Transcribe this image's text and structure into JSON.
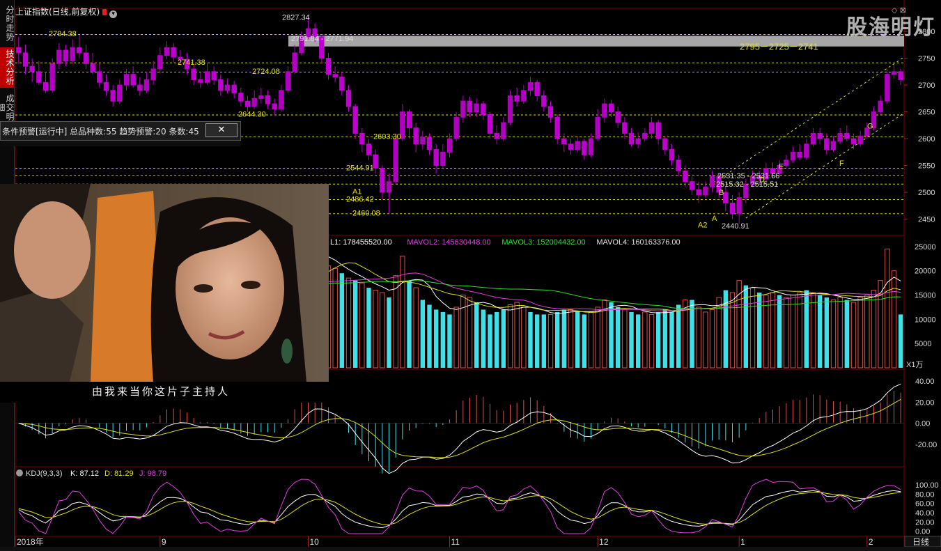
{
  "window": {
    "title": "上证指数(日线,前复权)",
    "watermark": "股海明灯",
    "period_tab": "日线"
  },
  "side_tabs": [
    {
      "label": "分时走势",
      "active": false
    },
    {
      "label": "技术分析",
      "active": true
    },
    {
      "label": "成交明细",
      "active": false
    }
  ],
  "warning_panel": {
    "text": "条件预警[运行中] 总品种数:55 趋势预警:20 条数:45",
    "close": "✕"
  },
  "video": {
    "subtitle": "由我来当你这片子主持人"
  },
  "colors": {
    "up": "#b000c0",
    "down": "#c000d0",
    "hollow_up": "#d4c200",
    "vol_up": "#e05050",
    "vol_down": "#40e0e8",
    "ma1": "#ffffff",
    "ma2": "#e040e0",
    "ma3": "#30e030",
    "ma4": "#e0e020",
    "dash": "#e0e030",
    "grid": "#7a0000"
  },
  "price_panel": {
    "y_ticks": [
      "2800",
      "2750",
      "2700",
      "2650",
      "2600",
      "2550",
      "2500",
      "2450"
    ],
    "annotations": [
      {
        "text": "2827.34"
      },
      {
        "text": "2791.84 - 2771.94"
      },
      {
        "text": "2794.38"
      },
      {
        "text": "2741.38"
      },
      {
        "text": "2724.08"
      },
      {
        "text": "2644.30"
      },
      {
        "text": "2603.30"
      },
      {
        "text": "2544.91"
      },
      {
        "text": "A1"
      },
      {
        "text": "2486.42"
      },
      {
        "text": "2460.08"
      },
      {
        "text": "2795－2725－2741"
      },
      {
        "text": "2531.35 - 2531.66"
      },
      {
        "text": "2515.32 - 2515.51"
      },
      {
        "text": "A2"
      },
      {
        "text": "2440.91"
      },
      {
        "text": "A"
      },
      {
        "text": "B"
      },
      {
        "text": "D"
      },
      {
        "text": "E"
      },
      {
        "text": "F"
      },
      {
        "text": "G"
      }
    ]
  },
  "volume_panel": {
    "legend": [
      {
        "text": "L1: 178455520.00",
        "color": "#ffffff"
      },
      {
        "text": "MAVOL2: 145630448.00",
        "color": "#e040e0"
      },
      {
        "text": "MAVOL3: 152004432.00",
        "color": "#30e030"
      },
      {
        "text": "MAVOL4: 160163376.00",
        "color": "#e0e0e0"
      }
    ],
    "y_ticks": [
      "25000",
      "20000",
      "15000",
      "10000",
      "5000"
    ],
    "unit": "X1万"
  },
  "macd_panel": {
    "y_ticks": [
      "40.00",
      "20.00",
      "0.00",
      "-20.00"
    ]
  },
  "kdj_panel": {
    "name": "KDJ(9,3,3)",
    "k": "K: 87.12",
    "d": "D: 81.29",
    "j": "J: 98.79",
    "y_ticks": [
      "100.00",
      "80.00",
      "60.00",
      "40.00",
      "20.00",
      "0.00"
    ]
  },
  "x_axis": {
    "labels": [
      "2018年",
      "9",
      "10",
      "11",
      "12",
      "1",
      "2"
    ]
  },
  "chart_data": {
    "type": "candlestick",
    "title": "上证指数(日线,前复权)",
    "ylim": [
      2430,
      2830
    ],
    "candles": [
      [
        2770,
        2760,
        2790,
        2740
      ],
      [
        2760,
        2735,
        2775,
        2720
      ],
      [
        2735,
        2725,
        2750,
        2705
      ],
      [
        2725,
        2705,
        2745,
        2700
      ],
      [
        2705,
        2690,
        2725,
        2685
      ],
      [
        2690,
        2740,
        2750,
        2685
      ],
      [
        2740,
        2765,
        2778,
        2730
      ],
      [
        2765,
        2745,
        2775,
        2735
      ],
      [
        2745,
        2770,
        2785,
        2738
      ],
      [
        2770,
        2760,
        2794,
        2750
      ],
      [
        2760,
        2740,
        2775,
        2730
      ],
      [
        2740,
        2725,
        2760,
        2720
      ],
      [
        2725,
        2705,
        2740,
        2695
      ],
      [
        2705,
        2690,
        2720,
        2680
      ],
      [
        2690,
        2670,
        2700,
        2660
      ],
      [
        2670,
        2700,
        2710,
        2665
      ],
      [
        2700,
        2720,
        2730,
        2690
      ],
      [
        2720,
        2700,
        2735,
        2695
      ],
      [
        2700,
        2690,
        2715,
        2680
      ],
      [
        2690,
        2710,
        2725,
        2685
      ],
      [
        2710,
        2730,
        2745,
        2700
      ],
      [
        2730,
        2755,
        2770,
        2722
      ],
      [
        2755,
        2770,
        2782,
        2748
      ],
      [
        2770,
        2752,
        2778,
        2742
      ],
      [
        2752,
        2748,
        2765,
        2740
      ],
      [
        2748,
        2730,
        2760,
        2720
      ],
      [
        2730,
        2710,
        2740,
        2700
      ],
      [
        2710,
        2705,
        2725,
        2695
      ],
      [
        2705,
        2725,
        2741,
        2700
      ],
      [
        2725,
        2710,
        2735,
        2700
      ],
      [
        2710,
        2690,
        2720,
        2680
      ],
      [
        2690,
        2700,
        2712,
        2684
      ],
      [
        2700,
        2685,
        2708,
        2675
      ],
      [
        2685,
        2670,
        2695,
        2660
      ],
      [
        2670,
        2660,
        2680,
        2650
      ],
      [
        2660,
        2675,
        2690,
        2655
      ],
      [
        2675,
        2680,
        2695,
        2665
      ],
      [
        2680,
        2665,
        2690,
        2655
      ],
      [
        2665,
        2655,
        2675,
        2644
      ],
      [
        2655,
        2690,
        2700,
        2650
      ],
      [
        2690,
        2725,
        2735,
        2685
      ],
      [
        2725,
        2760,
        2775,
        2720
      ],
      [
        2760,
        2790,
        2800,
        2755
      ],
      [
        2790,
        2805,
        2827,
        2785
      ],
      [
        2805,
        2790,
        2815,
        2780
      ],
      [
        2790,
        2750,
        2792,
        2740
      ],
      [
        2750,
        2720,
        2760,
        2710
      ],
      [
        2720,
        2715,
        2735,
        2705
      ],
      [
        2715,
        2690,
        2725,
        2680
      ],
      [
        2690,
        2660,
        2700,
        2650
      ],
      [
        2660,
        2610,
        2665,
        2600
      ],
      [
        2610,
        2590,
        2620,
        2575
      ],
      [
        2590,
        2570,
        2600,
        2560
      ],
      [
        2570,
        2545,
        2580,
        2535
      ],
      [
        2545,
        2500,
        2550,
        2486
      ],
      [
        2500,
        2520,
        2535,
        2460
      ],
      [
        2520,
        2600,
        2610,
        2515
      ],
      [
        2600,
        2650,
        2665,
        2595
      ],
      [
        2650,
        2620,
        2655,
        2600
      ],
      [
        2620,
        2590,
        2630,
        2575
      ],
      [
        2590,
        2603,
        2615,
        2580
      ],
      [
        2603,
        2580,
        2610,
        2570
      ],
      [
        2580,
        2550,
        2590,
        2535
      ],
      [
        2550,
        2575,
        2590,
        2544
      ],
      [
        2575,
        2600,
        2610,
        2565
      ],
      [
        2600,
        2640,
        2650,
        2595
      ],
      [
        2640,
        2670,
        2680,
        2630
      ],
      [
        2670,
        2650,
        2678,
        2640
      ],
      [
        2650,
        2665,
        2675,
        2640
      ],
      [
        2665,
        2645,
        2670,
        2635
      ],
      [
        2645,
        2610,
        2650,
        2600
      ],
      [
        2610,
        2600,
        2625,
        2590
      ],
      [
        2600,
        2630,
        2640,
        2595
      ],
      [
        2630,
        2680,
        2690,
        2625
      ],
      [
        2680,
        2670,
        2695,
        2660
      ],
      [
        2670,
        2690,
        2700,
        2665
      ],
      [
        2690,
        2705,
        2715,
        2680
      ],
      [
        2705,
        2680,
        2710,
        2670
      ],
      [
        2680,
        2660,
        2690,
        2650
      ],
      [
        2660,
        2640,
        2670,
        2630
      ],
      [
        2640,
        2600,
        2645,
        2590
      ],
      [
        2600,
        2590,
        2610,
        2575
      ],
      [
        2590,
        2580,
        2600,
        2570
      ],
      [
        2580,
        2595,
        2605,
        2575
      ],
      [
        2595,
        2570,
        2600,
        2560
      ],
      [
        2570,
        2600,
        2610,
        2565
      ],
      [
        2600,
        2640,
        2655,
        2595
      ],
      [
        2640,
        2665,
        2675,
        2630
      ],
      [
        2665,
        2650,
        2672,
        2640
      ],
      [
        2650,
        2630,
        2660,
        2620
      ],
      [
        2630,
        2610,
        2640,
        2600
      ],
      [
        2610,
        2590,
        2620,
        2585
      ],
      [
        2590,
        2600,
        2612,
        2582
      ],
      [
        2600,
        2610,
        2620,
        2595
      ],
      [
        2610,
        2630,
        2640,
        2600
      ],
      [
        2630,
        2600,
        2635,
        2590
      ],
      [
        2600,
        2580,
        2605,
        2570
      ],
      [
        2580,
        2560,
        2590,
        2550
      ],
      [
        2560,
        2540,
        2570,
        2530
      ],
      [
        2540,
        2520,
        2550,
        2510
      ],
      [
        2520,
        2505,
        2530,
        2495
      ],
      [
        2505,
        2495,
        2520,
        2480
      ],
      [
        2495,
        2510,
        2520,
        2490
      ],
      [
        2510,
        2530,
        2540,
        2500
      ],
      [
        2530,
        2500,
        2535,
        2490
      ],
      [
        2500,
        2480,
        2510,
        2465
      ],
      [
        2480,
        2460,
        2495,
        2450
      ],
      [
        2460,
        2490,
        2500,
        2441
      ],
      [
        2490,
        2515,
        2525,
        2480
      ],
      [
        2515,
        2530,
        2540,
        2510
      ],
      [
        2530,
        2525,
        2540,
        2515
      ],
      [
        2525,
        2545,
        2555,
        2520
      ],
      [
        2545,
        2535,
        2556,
        2528
      ],
      [
        2535,
        2550,
        2560,
        2530
      ],
      [
        2550,
        2560,
        2570,
        2545
      ],
      [
        2560,
        2575,
        2585,
        2555
      ],
      [
        2575,
        2565,
        2590,
        2560
      ],
      [
        2565,
        2590,
        2600,
        2560
      ],
      [
        2590,
        2610,
        2620,
        2585
      ],
      [
        2610,
        2600,
        2620,
        2590
      ],
      [
        2600,
        2580,
        2610,
        2570
      ],
      [
        2580,
        2595,
        2605,
        2575
      ],
      [
        2595,
        2610,
        2620,
        2590
      ],
      [
        2610,
        2600,
        2625,
        2595
      ],
      [
        2600,
        2590,
        2610,
        2580
      ],
      [
        2590,
        2605,
        2615,
        2585
      ],
      [
        2605,
        2620,
        2630,
        2600
      ],
      [
        2620,
        2650,
        2660,
        2615
      ],
      [
        2650,
        2670,
        2680,
        2645
      ],
      [
        2670,
        2720,
        2730,
        2665
      ],
      [
        2720,
        2725,
        2740,
        2712
      ],
      [
        2725,
        2710,
        2730,
        2700
      ]
    ],
    "volume": [
      [
        12000,
        -1
      ],
      [
        13500,
        -1
      ],
      [
        14000,
        -1
      ],
      [
        13000,
        -1
      ],
      [
        14500,
        -1
      ],
      [
        16000,
        1
      ],
      [
        19000,
        1
      ],
      [
        18000,
        -1
      ],
      [
        20000,
        1
      ],
      [
        17000,
        -1
      ],
      [
        16000,
        -1
      ],
      [
        14000,
        -1
      ],
      [
        13500,
        1
      ],
      [
        14000,
        -1
      ],
      [
        13000,
        -1
      ],
      [
        18000,
        1
      ],
      [
        19000,
        1
      ],
      [
        17000,
        1
      ],
      [
        16000,
        -1
      ],
      [
        15000,
        1
      ],
      [
        17500,
        1
      ],
      [
        20000,
        1
      ],
      [
        21000,
        -1
      ],
      [
        19000,
        -1
      ],
      [
        20000,
        -1
      ],
      [
        17500,
        -1
      ],
      [
        16500,
        -1
      ],
      [
        18000,
        1
      ],
      [
        18500,
        1
      ],
      [
        17000,
        -1
      ],
      [
        16500,
        1
      ],
      [
        15500,
        -1
      ],
      [
        14500,
        -1
      ],
      [
        15000,
        1
      ],
      [
        13500,
        -1
      ],
      [
        13000,
        -1
      ],
      [
        14500,
        1
      ],
      [
        13000,
        -1
      ],
      [
        12500,
        -1
      ],
      [
        15000,
        1
      ],
      [
        19000,
        1
      ],
      [
        24500,
        1
      ],
      [
        24000,
        -1
      ],
      [
        24500,
        1
      ],
      [
        23000,
        1
      ],
      [
        22000,
        -1
      ],
      [
        21000,
        1
      ],
      [
        20500,
        1
      ],
      [
        19500,
        -1
      ],
      [
        18500,
        1
      ],
      [
        18000,
        -1
      ],
      [
        17500,
        1
      ],
      [
        16500,
        -1
      ],
      [
        16000,
        1
      ],
      [
        15500,
        1
      ],
      [
        14500,
        -1
      ],
      [
        19000,
        1
      ],
      [
        23000,
        1
      ],
      [
        18000,
        -1
      ],
      [
        16500,
        1
      ],
      [
        14000,
        -1
      ],
      [
        13000,
        -1
      ],
      [
        12000,
        -1
      ],
      [
        11500,
        -1
      ],
      [
        11000,
        -1
      ],
      [
        12500,
        1
      ],
      [
        15000,
        1
      ],
      [
        14500,
        1
      ],
      [
        13500,
        -1
      ],
      [
        12000,
        -1
      ],
      [
        11000,
        -1
      ],
      [
        11500,
        -1
      ],
      [
        12000,
        -1
      ],
      [
        13000,
        1
      ],
      [
        13500,
        1
      ],
      [
        12500,
        1
      ],
      [
        11500,
        -1
      ],
      [
        11000,
        -1
      ],
      [
        11000,
        -1
      ],
      [
        11000,
        1
      ],
      [
        11500,
        -1
      ],
      [
        12000,
        -1
      ],
      [
        12000,
        1
      ],
      [
        11500,
        -1
      ],
      [
        11000,
        -1
      ],
      [
        11500,
        1
      ],
      [
        12500,
        1
      ],
      [
        14000,
        1
      ],
      [
        13500,
        -1
      ],
      [
        12500,
        -1
      ],
      [
        12000,
        1
      ],
      [
        11500,
        -1
      ],
      [
        11000,
        -1
      ],
      [
        11500,
        1
      ],
      [
        11000,
        1
      ],
      [
        11500,
        -1
      ],
      [
        12000,
        -1
      ],
      [
        11500,
        -1
      ],
      [
        13000,
        -1
      ],
      [
        14000,
        1
      ],
      [
        14000,
        -1
      ],
      [
        12500,
        1
      ],
      [
        11500,
        1
      ],
      [
        12000,
        1
      ],
      [
        14500,
        1
      ],
      [
        16000,
        -1
      ],
      [
        15500,
        1
      ],
      [
        18000,
        1
      ],
      [
        17000,
        -1
      ],
      [
        16500,
        1
      ],
      [
        15500,
        -1
      ],
      [
        15000,
        1
      ],
      [
        15500,
        1
      ],
      [
        15000,
        -1
      ],
      [
        14500,
        1
      ],
      [
        15000,
        1
      ],
      [
        15500,
        1
      ],
      [
        16000,
        -1
      ],
      [
        15500,
        1
      ],
      [
        15000,
        -1
      ],
      [
        14500,
        -1
      ],
      [
        14000,
        1
      ],
      [
        14500,
        1
      ],
      [
        14000,
        -1
      ],
      [
        13500,
        1
      ],
      [
        14500,
        1
      ],
      [
        15000,
        1
      ],
      [
        16000,
        1
      ],
      [
        18000,
        1
      ],
      [
        24500,
        1
      ],
      [
        20000,
        1
      ],
      [
        11000,
        -1
      ]
    ]
  }
}
